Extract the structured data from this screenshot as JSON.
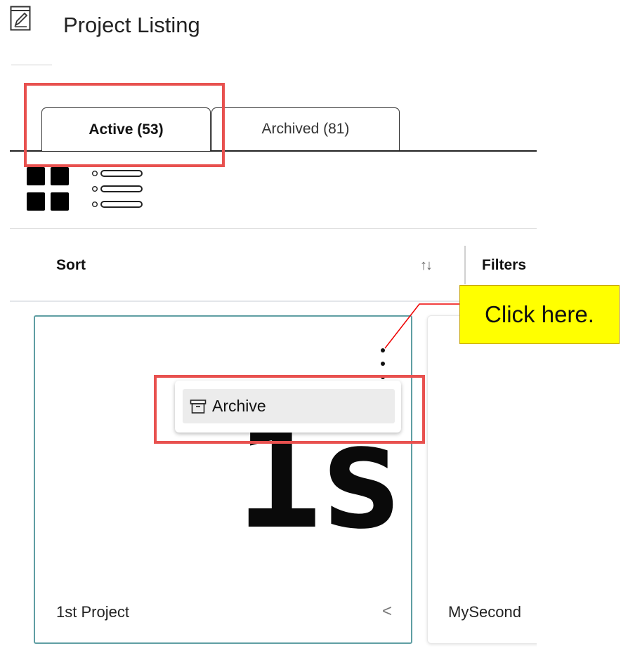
{
  "header": {
    "title": "Project Listing",
    "icon": "edit-document-icon"
  },
  "tabs": [
    {
      "label": "Active (53)",
      "selected": true
    },
    {
      "label": "Archived (81)",
      "selected": false
    }
  ],
  "view_toggles": {
    "grid_icon": "grid-view-icon",
    "list_icon": "list-view-icon"
  },
  "toolbar": {
    "sort_label": "Sort",
    "sort_icon": "↑↓",
    "filters_label": "Filters"
  },
  "cards": [
    {
      "name": "1st Project",
      "thumbnail_text": "1s",
      "chevron": "<"
    },
    {
      "name": "MySecond"
    }
  ],
  "context_menu": {
    "items": [
      {
        "label": "Archive",
        "icon": "archive-icon"
      }
    ]
  },
  "annotation": {
    "callout_text": "Click here.",
    "highlight_color": "#e8514f",
    "callout_color": "#ffff00"
  },
  "colors": {
    "card_border": "#5f9ea3"
  }
}
